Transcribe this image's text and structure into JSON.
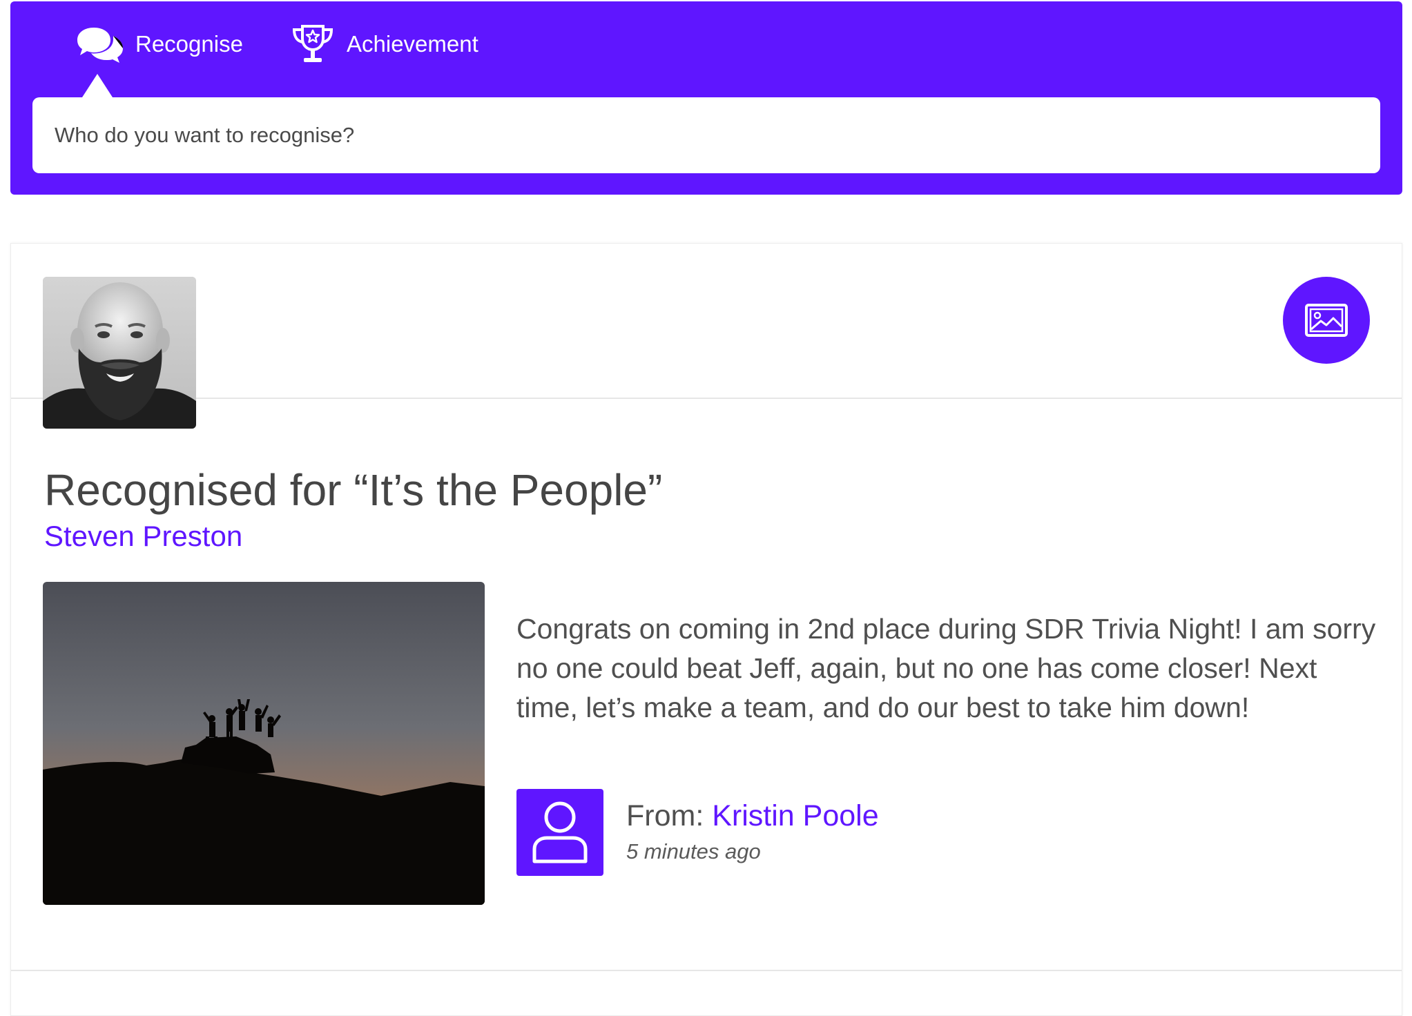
{
  "colors": {
    "brand": "#5f16ff",
    "text": "#4f4f4f",
    "link": "#5f16ff"
  },
  "header": {
    "tabs": [
      {
        "label": "Recognise",
        "icon": "speech-bubbles-icon",
        "active": true
      },
      {
        "label": "Achievement",
        "icon": "trophy-icon",
        "active": false
      }
    ],
    "search": {
      "placeholder": "Who do you want to recognise?"
    }
  },
  "card": {
    "recipient_avatar_icon": "profile-photo",
    "image_button_icon": "image-icon",
    "title": "Recognised for “It’s the People”",
    "recipient_name": "Steven Preston",
    "photo_icon": "mountain-summit-photo",
    "message": "Congrats on coming in 2nd place during SDR Trivia Night! I am sorry no one could beat Jeff, again, but no one has come closer! Next time, let’s make a team, and do our best to take him down!",
    "from": {
      "label": "From:",
      "name": "Kristin Poole",
      "avatar_icon": "user-icon",
      "timestamp": "5 minutes ago"
    }
  }
}
